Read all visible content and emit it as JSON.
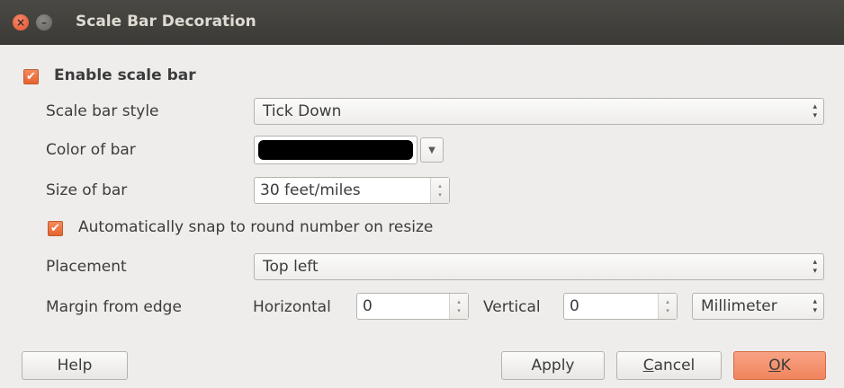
{
  "window": {
    "title": "Scale Bar Decoration",
    "close_glyph": "×",
    "minimize_glyph": "–"
  },
  "enable": {
    "label": "Enable scale bar",
    "checked": true
  },
  "style": {
    "label": "Scale bar style",
    "value": "Tick Down"
  },
  "color": {
    "label": "Color of bar",
    "value": "#000000"
  },
  "size": {
    "label": "Size of bar",
    "value": "30 feet/miles"
  },
  "snap": {
    "label": "Automatically snap to round number on resize",
    "checked": true
  },
  "placement": {
    "label": "Placement",
    "value": "Top left"
  },
  "margin": {
    "label": "Margin from edge",
    "horizontal_label": "Horizontal",
    "horizontal_value": "0",
    "vertical_label": "Vertical",
    "vertical_value": "0",
    "unit": "Millimeter"
  },
  "buttons": {
    "help": "Help",
    "apply": "Apply",
    "cancel_first": "C",
    "cancel_rest": "ancel",
    "ok_first": "O",
    "ok_rest": "K"
  },
  "icons": {
    "check": "✔",
    "spin_up": "▴",
    "spin_down": "▾",
    "dropdown": "▼"
  },
  "colors": {
    "accent": "#f0855d",
    "titlebar": "#3b3a36",
    "background": "#efedeb"
  }
}
